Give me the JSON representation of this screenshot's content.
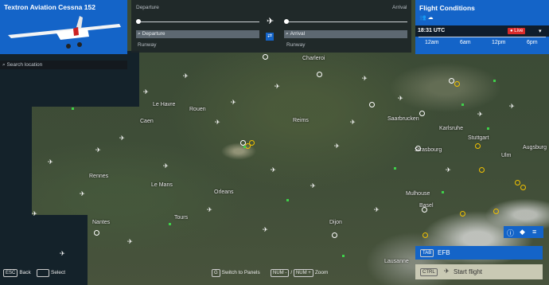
{
  "aircraft": {
    "name": "Textron Aviation Cessna 152"
  },
  "search": {
    "placeholder": "Search location"
  },
  "route": {
    "departure_label": "Departure",
    "arrival_label": "Arrival",
    "departure_field": "Departure",
    "arrival_field": "Arrival",
    "runway_left": "Runway",
    "runway_right": "Runway"
  },
  "conditions": {
    "title": "Flight Conditions",
    "time": "18:31 UTC",
    "live": "Live",
    "hours": [
      "12am",
      "6am",
      "12pm",
      "6pm"
    ]
  },
  "cities": [
    "Charleroi",
    "Le Havre",
    "Rouen",
    "Caen",
    "Reims",
    "Saarbrucken",
    "Karlsruhe",
    "Strasbourg",
    "Stuttgart",
    "Ulm",
    "Augsburg",
    "Rennes",
    "Le Mans",
    "Orleans",
    "Tours",
    "Nantes",
    "Dijon",
    "Mulhouse",
    "Basel",
    "Lausanne"
  ],
  "footer": {
    "back_key": "ESC",
    "back": "Back",
    "select": "Select",
    "panels_key": "G",
    "panels": "Switch to Panels",
    "zoom_minus_key": "NUM -",
    "zoom_plus_key": "NUM +",
    "zoom": "Zoom",
    "efb_key": "TAB",
    "efb": "EFB",
    "start_key": "CTRL",
    "start": "Start flight"
  },
  "colors": {
    "panel_blue": "#1464c8",
    "live_red": "#d92b2b",
    "airport_yellow": "#f2c200"
  }
}
